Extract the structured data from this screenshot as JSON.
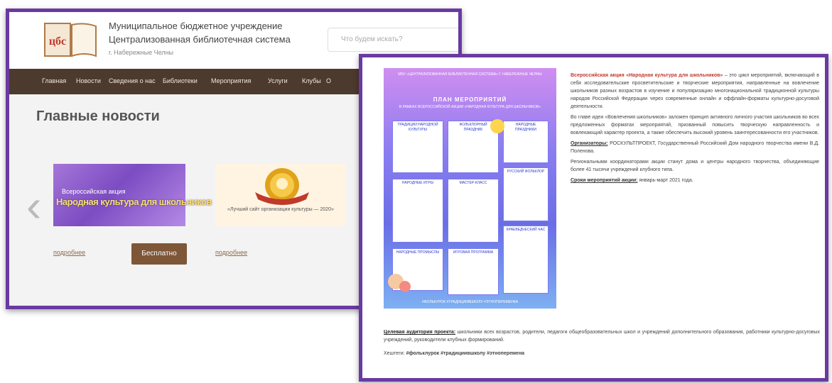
{
  "site": {
    "org_line1": "Муниципальное бюджетное учреждение",
    "org_line2": "Централизованная библиотечная система",
    "org_city": "г. Набережные Челны",
    "logo_text": "цбс",
    "search_placeholder": "Что будем искать?"
  },
  "nav": {
    "items": [
      "Главная",
      "Новости",
      "Сведения о нас",
      "Библиотеки",
      "Мероприятия",
      "Услуги",
      "Клубы",
      "О"
    ]
  },
  "news": {
    "title": "Главные новости",
    "card1": {
      "top_text": "Всероссийская акция",
      "main_text": "Народная культура для школьников"
    },
    "card2": {
      "caption": "«Лучший сайт организации культуры — 2020»"
    },
    "links": [
      "подробнее",
      "подробнее"
    ],
    "free_button": "Бесплатно"
  },
  "poster": {
    "header": "МБУ «ЦЕНТРАЛИЗОВАННАЯ БИБЛИОТЕЧНАЯ СИСТЕМА» Г. НАБЕРЕЖНЫЕ ЧЕЛНЫ",
    "plan_title": "ПЛАН МЕРОПРИЯТИЙ",
    "plan_desc": "В РАМКАХ ВСЕРОССИЙСКОЙ АКЦИИ «НАРОДНАЯ КУЛЬТУРА ДЛЯ ШКОЛЬНИКОВ»",
    "events": [
      "ТРАДИЦИИ НАРОДНОЙ КУЛЬТУРЫ",
      "ФОЛЬКЛОРНЫЙ ПРАЗДНИК",
      "НАРОДНЫЕ ПРАЗДНИКИ",
      "НАРОДНЫЕ ИГРЫ",
      "МАСТЕР-КЛАСС",
      "РУССКИЙ ФОЛЬКЛОР",
      "НАРОДНЫЕ ПРОМЫСЛЫ",
      "ИГРОВАЯ ПРОГРАММА",
      "КРАЕВЕДЧЕСКИЙ ЧАС"
    ],
    "hashtags": "#ФОЛЬКУРОК #ТРАДИЦИИВШКОЛУ #ЭТНОПЕРЕМЕНКА"
  },
  "article": {
    "heading": "Всероссийская акция «Народная культура для школьников»",
    "p1": "– это цикл мероприятий, включающий в себя исследовательские просветительские и творческие мероприятия, направленные на вовлечение школьников разных возрастов в изучение и популяризацию многонациональной традиционной культуры народов Российской Федерации через современные онлайн и оффлайн-форматы культурно-досуговой деятельности.",
    "p2": "Во главе идеи «Вовлечения школьников» заложен принцип активного личного участия школьников во всех предложенных форматах мероприятий, призванный повысить творческую направленность и вовлекающий характер проекта, а также обеспечить высокий уровень заинтересованности его участников.",
    "org_label": "Организаторы:",
    "org_text": "РОСКУЛЬТПРОЕКТ, Государственный Российский Дом народного творчества имени В.Д. Поленова.",
    "p4": "Региональными координаторами акции станут дома и центры народного творчества, объединяющие более 41 тысячи учреждений клубного типа.",
    "dates_label": "Сроки мероприятий акции:",
    "dates_text": "январь-март 2021 года.",
    "audience_label": "Целевая аудитория проекта:",
    "audience_text": "школьники всех возрастов, родители, педагоги общеобразовательных школ и учреждений дополнительного образования, работники культурно-досуговых учреждений, руководители клубных формирований.",
    "hashtags_label": "Хештеги:",
    "hashtags": "#фольклурок #традициившколу #этноперемена"
  }
}
